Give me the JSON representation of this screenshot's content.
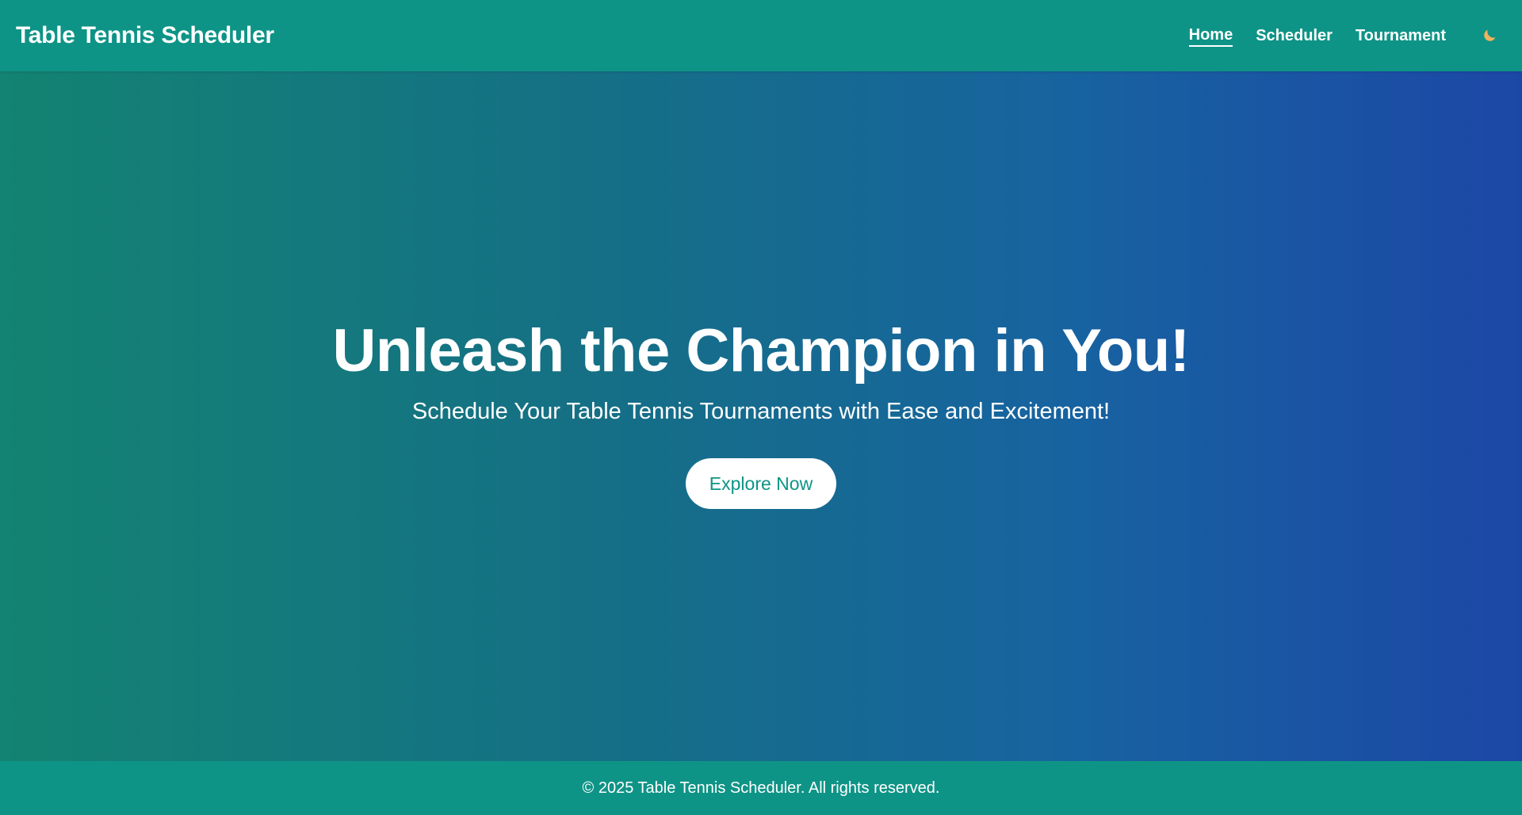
{
  "header": {
    "brand": "Table Tennis Scheduler",
    "nav": [
      {
        "label": "Home",
        "active": true
      },
      {
        "label": "Scheduler",
        "active": false
      },
      {
        "label": "Tournament",
        "active": false
      }
    ],
    "theme_toggle_icon": "moon-icon"
  },
  "hero": {
    "title": "Unleash the Champion in You!",
    "subtitle": "Schedule Your Table Tennis Tournaments with Ease and Excitement!",
    "cta_label": "Explore Now"
  },
  "footer": {
    "text": "© 2025 Table Tennis Scheduler. All rights reserved."
  },
  "colors": {
    "primary": "#0e9486",
    "gradient_start": "#138372",
    "gradient_end": "#1c47a6",
    "moon": "#f2b25c"
  }
}
